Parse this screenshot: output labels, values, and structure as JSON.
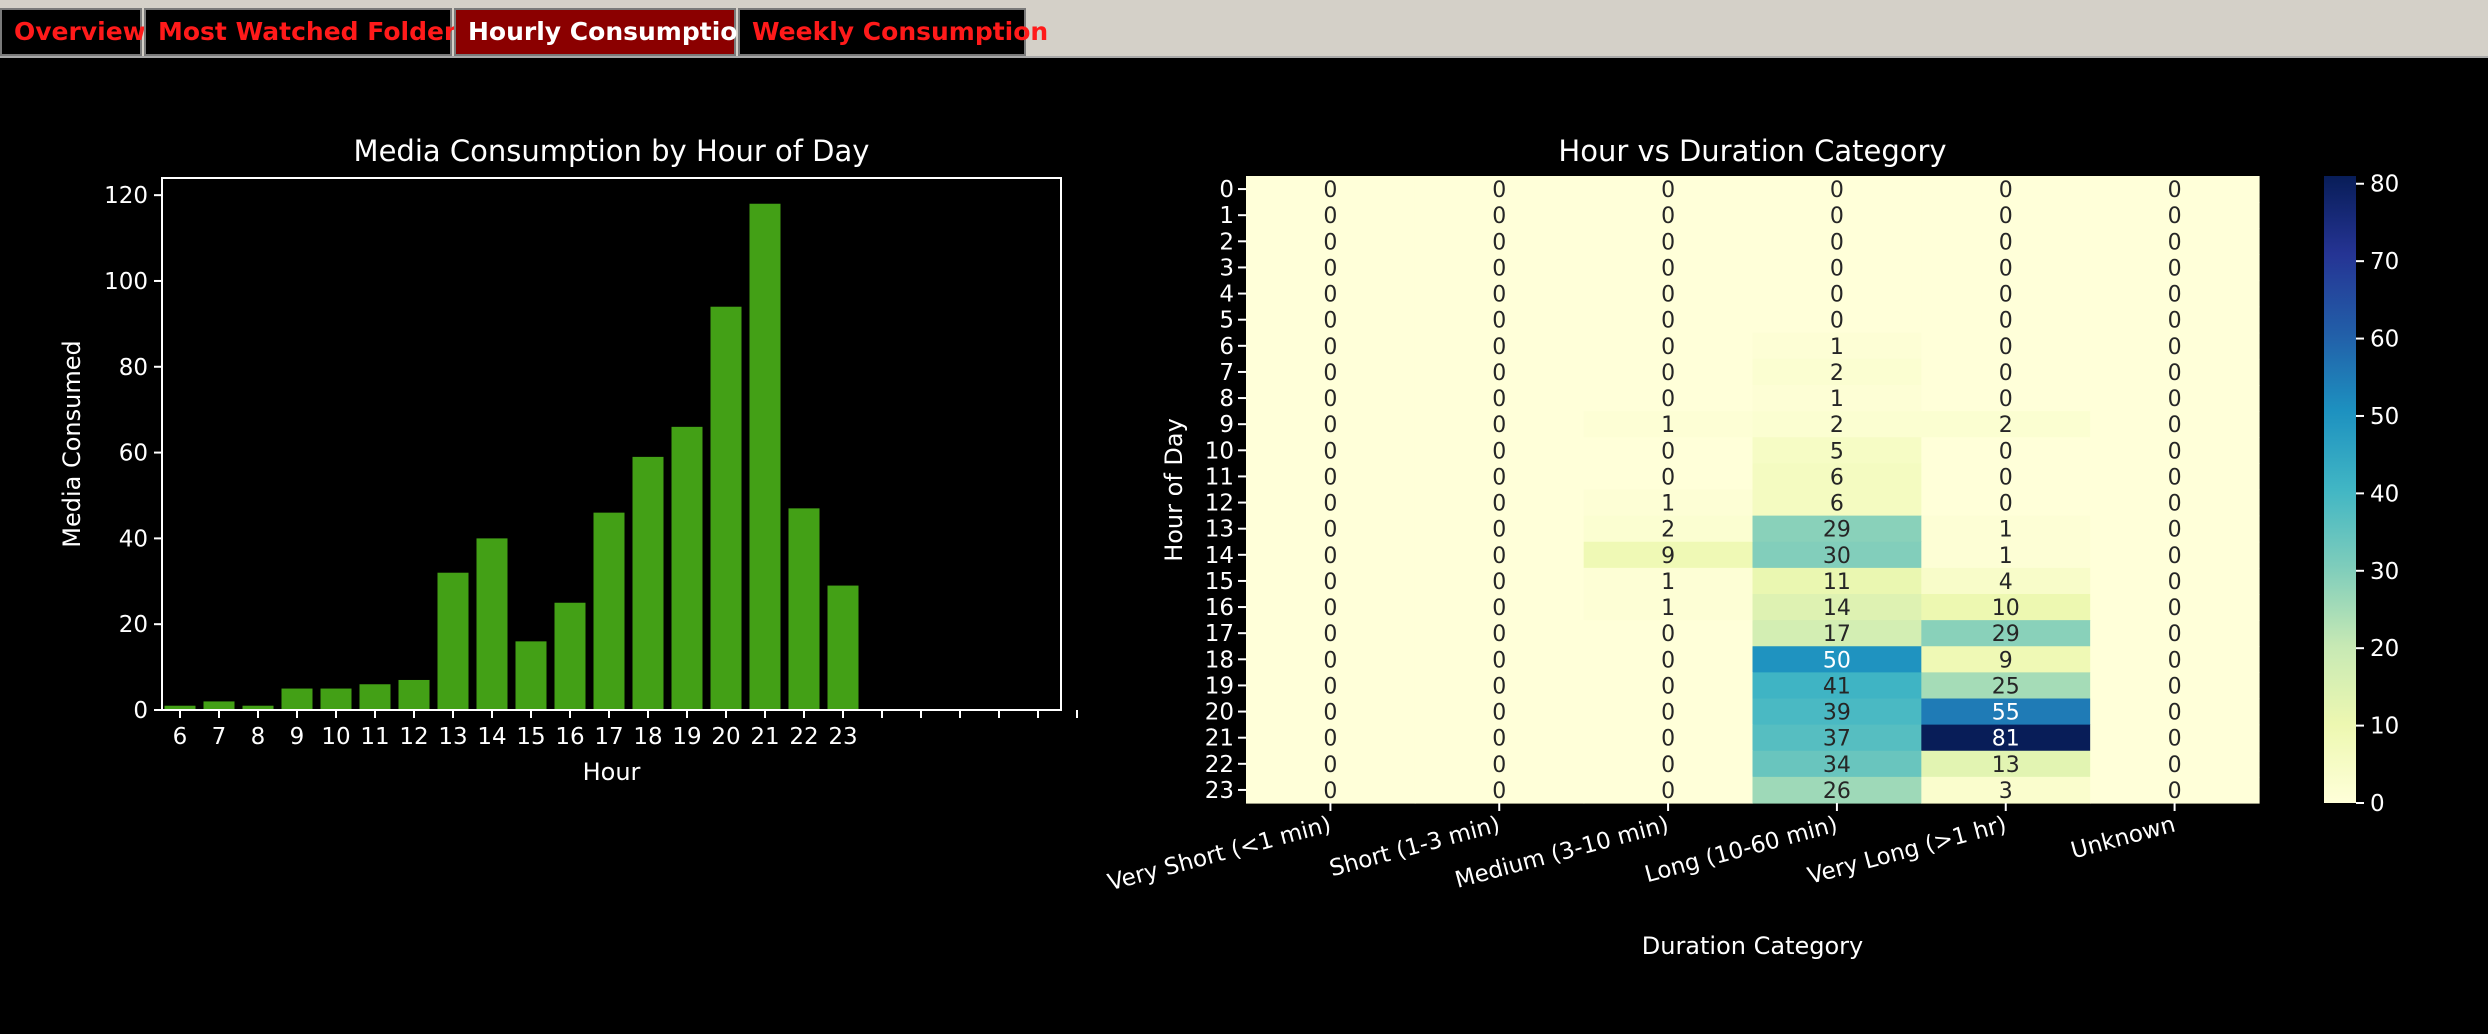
{
  "tabs": [
    {
      "label": "Overview",
      "active": false
    },
    {
      "label": "Most Watched Folders",
      "active": false
    },
    {
      "label": "Hourly Consumption",
      "active": true
    },
    {
      "label": "Weekly Consumption",
      "active": false
    }
  ],
  "colors": {
    "tabbar_bg": "#d4d0c8",
    "tab_text": "#ff1a1a",
    "active_tab_bg": "#8b0000",
    "bar_fill": "#43a016",
    "colormap": "YlGnBu"
  },
  "chart_data": [
    {
      "type": "bar",
      "title": "Media Consumption by Hour of Day",
      "xlabel": "Hour",
      "ylabel": "Media Consumed",
      "categories": [
        "6",
        "7",
        "8",
        "9",
        "10",
        "11",
        "12",
        "13",
        "14",
        "15",
        "16",
        "17",
        "18",
        "19",
        "20",
        "21",
        "22",
        "23"
      ],
      "values": [
        1,
        2,
        1,
        5,
        5,
        6,
        7,
        32,
        40,
        16,
        25,
        46,
        59,
        66,
        94,
        118,
        47,
        29
      ],
      "ylim": [
        0,
        124
      ],
      "yticks": [
        0,
        20,
        40,
        60,
        80,
        100,
        120
      ],
      "grid": false
    },
    {
      "type": "heatmap",
      "title": "Hour vs Duration Category",
      "xlabel": "Duration Category",
      "ylabel": "Hour of Day",
      "x": [
        "Very Short (<1 min)",
        "Short (1-3 min)",
        "Medium (3-10 min)",
        "Long (10-60 min)",
        "Very Long (>1 hr)",
        "Unknown"
      ],
      "y": [
        "0",
        "1",
        "2",
        "3",
        "4",
        "5",
        "6",
        "7",
        "8",
        "9",
        "10",
        "11",
        "12",
        "13",
        "14",
        "15",
        "16",
        "17",
        "18",
        "19",
        "20",
        "21",
        "22",
        "23"
      ],
      "values": [
        [
          0,
          0,
          0,
          0,
          0,
          0
        ],
        [
          0,
          0,
          0,
          0,
          0,
          0
        ],
        [
          0,
          0,
          0,
          0,
          0,
          0
        ],
        [
          0,
          0,
          0,
          0,
          0,
          0
        ],
        [
          0,
          0,
          0,
          0,
          0,
          0
        ],
        [
          0,
          0,
          0,
          0,
          0,
          0
        ],
        [
          0,
          0,
          0,
          1,
          0,
          0
        ],
        [
          0,
          0,
          0,
          2,
          0,
          0
        ],
        [
          0,
          0,
          0,
          1,
          0,
          0
        ],
        [
          0,
          0,
          1,
          2,
          2,
          0
        ],
        [
          0,
          0,
          0,
          5,
          0,
          0
        ],
        [
          0,
          0,
          0,
          6,
          0,
          0
        ],
        [
          0,
          0,
          1,
          6,
          0,
          0
        ],
        [
          0,
          0,
          2,
          29,
          1,
          0
        ],
        [
          0,
          0,
          9,
          30,
          1,
          0
        ],
        [
          0,
          0,
          1,
          11,
          4,
          0
        ],
        [
          0,
          0,
          1,
          14,
          10,
          0
        ],
        [
          0,
          0,
          0,
          17,
          29,
          0
        ],
        [
          0,
          0,
          0,
          50,
          9,
          0
        ],
        [
          0,
          0,
          0,
          41,
          25,
          0
        ],
        [
          0,
          0,
          0,
          39,
          55,
          0
        ],
        [
          0,
          0,
          0,
          37,
          81,
          0
        ],
        [
          0,
          0,
          0,
          34,
          13,
          0
        ],
        [
          0,
          0,
          0,
          26,
          3,
          0
        ]
      ],
      "colorbar": {
        "min": 0,
        "max": 81,
        "ticks": [
          0,
          10,
          20,
          30,
          40,
          50,
          60,
          70,
          80
        ]
      },
      "annotations": true
    }
  ]
}
